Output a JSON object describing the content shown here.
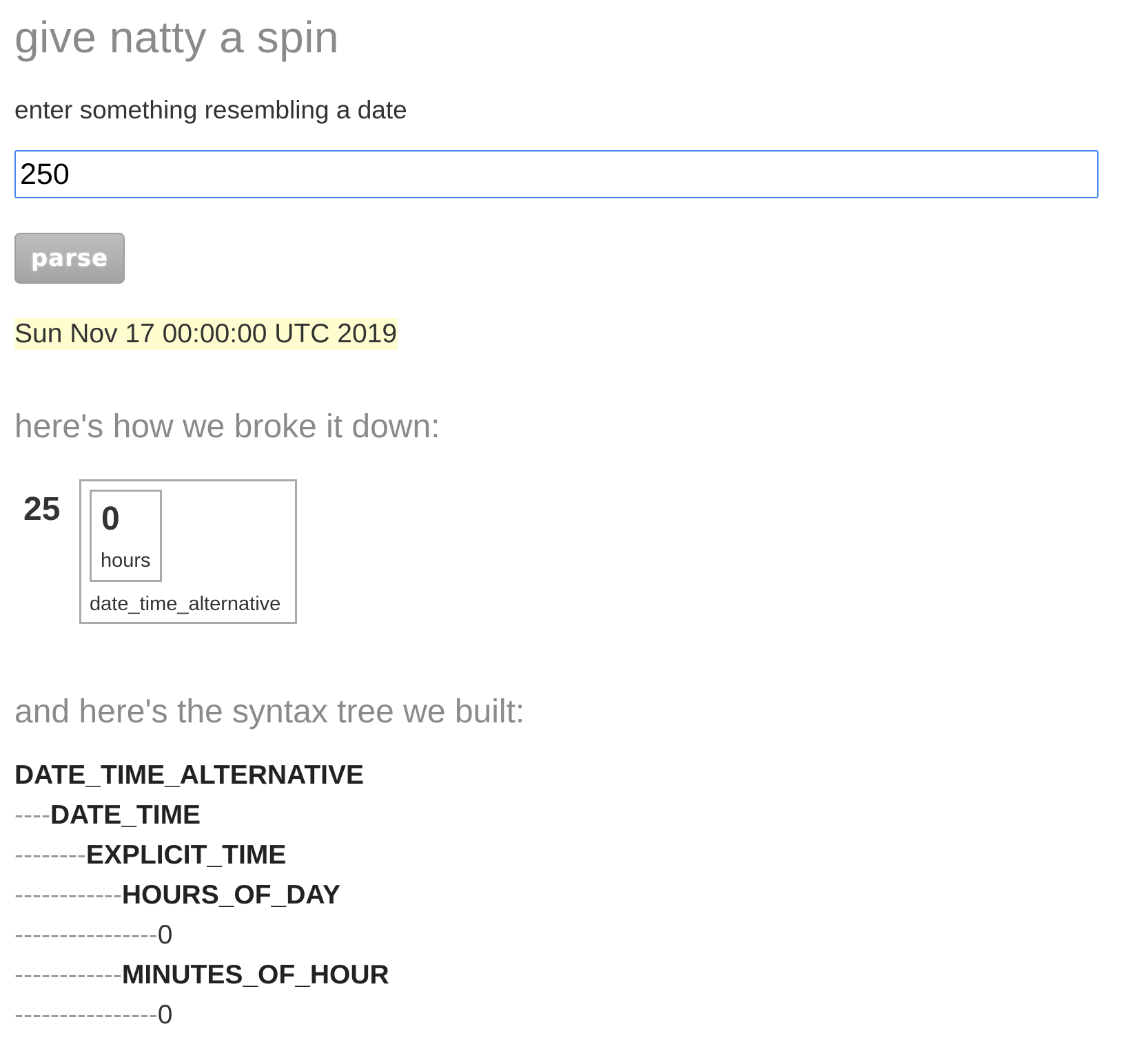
{
  "header": {
    "title": "give natty a spin"
  },
  "form": {
    "prompt": "enter something resembling a date",
    "input_value": "250",
    "parse_label": "parse"
  },
  "result": {
    "text": "Sun Nov 17 00:00:00 UTC 2019"
  },
  "breakdown": {
    "heading": "here's how we broke it down:",
    "token": "25",
    "group_label": "date_time_alternative",
    "part_value": "0",
    "part_label": "hours"
  },
  "tree": {
    "heading": "and here's the syntax tree we built:",
    "nodes": [
      {
        "prefix": "",
        "label": "DATE_TIME_ALTERNATIVE"
      },
      {
        "prefix": "----",
        "label": "DATE_TIME"
      },
      {
        "prefix": "--------",
        "label": "EXPLICIT_TIME"
      },
      {
        "prefix": "------------",
        "label": "HOURS_OF_DAY"
      },
      {
        "prefix": "----------------",
        "label": "0"
      },
      {
        "prefix": "------------",
        "label": "MINUTES_OF_HOUR"
      },
      {
        "prefix": "----------------",
        "label": "0"
      }
    ]
  }
}
